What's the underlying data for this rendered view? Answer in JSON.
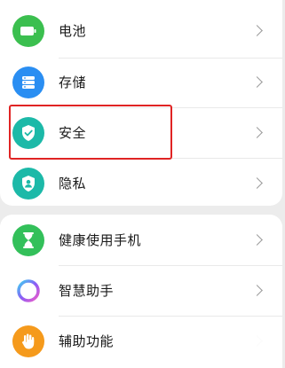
{
  "colors": {
    "battery": "#3bbf4f",
    "storage": "#2a8ef2",
    "security": "#1cb9a8",
    "privacy": "#1cb9a8",
    "health": "#33c05a",
    "assistant": "#8a5cf6",
    "accessibility": "#f59a1c",
    "highlight": "#e02424"
  },
  "settings": {
    "items": [
      {
        "label": "电池",
        "icon": "battery-icon"
      },
      {
        "label": "存储",
        "icon": "storage-icon"
      },
      {
        "label": "安全",
        "icon": "shield-icon"
      },
      {
        "label": "隐私",
        "icon": "privacy-icon"
      },
      {
        "label": "健康使用手机",
        "icon": "hourglass-icon"
      },
      {
        "label": "智慧助手",
        "icon": "assistant-ring-icon"
      },
      {
        "label": "辅助功能",
        "icon": "hand-icon"
      }
    ]
  }
}
